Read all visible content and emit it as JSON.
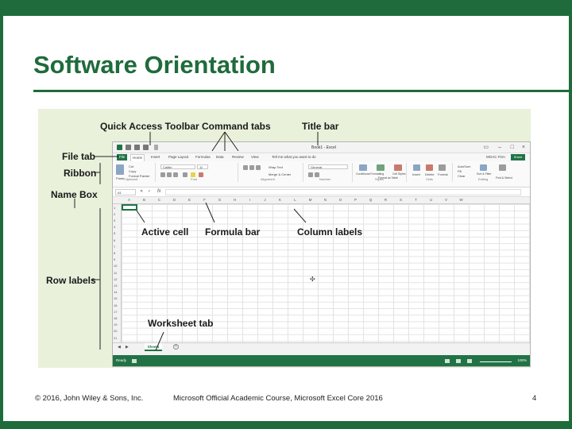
{
  "slide": {
    "title": "Software Orientation",
    "page_number": "4",
    "footer_left": "© 2016, John Wiley & Sons, Inc.",
    "footer_center": "Microsoft Official Academic Course, Microsoft Excel Core 2016",
    "accent_color": "#1f6b3b"
  },
  "callouts": {
    "quick_access_toolbar": "Quick Access Toolbar",
    "command_tabs": "Command tabs",
    "title_bar": "Title bar",
    "file_tab": "File tab",
    "ribbon": "Ribbon",
    "name_box": "Name Box",
    "active_cell": "Active cell",
    "formula_bar": "Formula bar",
    "column_labels": "Column labels",
    "row_labels": "Row labels",
    "worksheet_tab": "Worksheet tab"
  },
  "excel": {
    "window_title": "Book1 - Excel",
    "tabs": [
      "File",
      "Home",
      "Insert",
      "Page Layout",
      "Formulas",
      "Data",
      "Review",
      "View"
    ],
    "tell_me": "Tell me what you want to do",
    "user": "MOAC Firm",
    "share": "Share",
    "ribbon_groups": [
      "Clipboard",
      "Font",
      "Alignment",
      "Number",
      "Styles",
      "Cells",
      "Editing"
    ],
    "ribbon_items": {
      "cut": "Cut",
      "copy": "Copy",
      "format_painter": "Format Painter",
      "paste": "Paste",
      "font_name": "Calibri",
      "font_size": "11",
      "wrap_text": "Wrap Text",
      "merge_center": "Merge & Center",
      "number_format": "General",
      "conditional_formatting": "Conditional Formatting",
      "format_as_table": "Format as Table",
      "cell_styles": "Cell Styles",
      "insert": "Insert",
      "delete": "Delete",
      "format": "Format",
      "autosum": "AutoSum",
      "fill": "Fill",
      "clear": "Clear",
      "sort_filter": "Sort & Filter",
      "find_select": "Find & Select"
    },
    "name_box_value": "A1",
    "fx_label": "fx",
    "columns": [
      "A",
      "B",
      "C",
      "D",
      "E",
      "F",
      "G",
      "H",
      "I",
      "J",
      "K",
      "L",
      "M",
      "N",
      "O",
      "P",
      "Q",
      "R",
      "S",
      "T",
      "U",
      "V",
      "W"
    ],
    "rows": [
      "1",
      "2",
      "3",
      "4",
      "5",
      "6",
      "7",
      "8",
      "9",
      "10",
      "11",
      "12",
      "13",
      "14",
      "15",
      "16",
      "17",
      "18",
      "19",
      "20",
      "21"
    ],
    "sheet_tab": "Sheet1",
    "add_sheet": "+",
    "status_ready": "Ready",
    "zoom": "100%",
    "status_color": "#217346"
  }
}
